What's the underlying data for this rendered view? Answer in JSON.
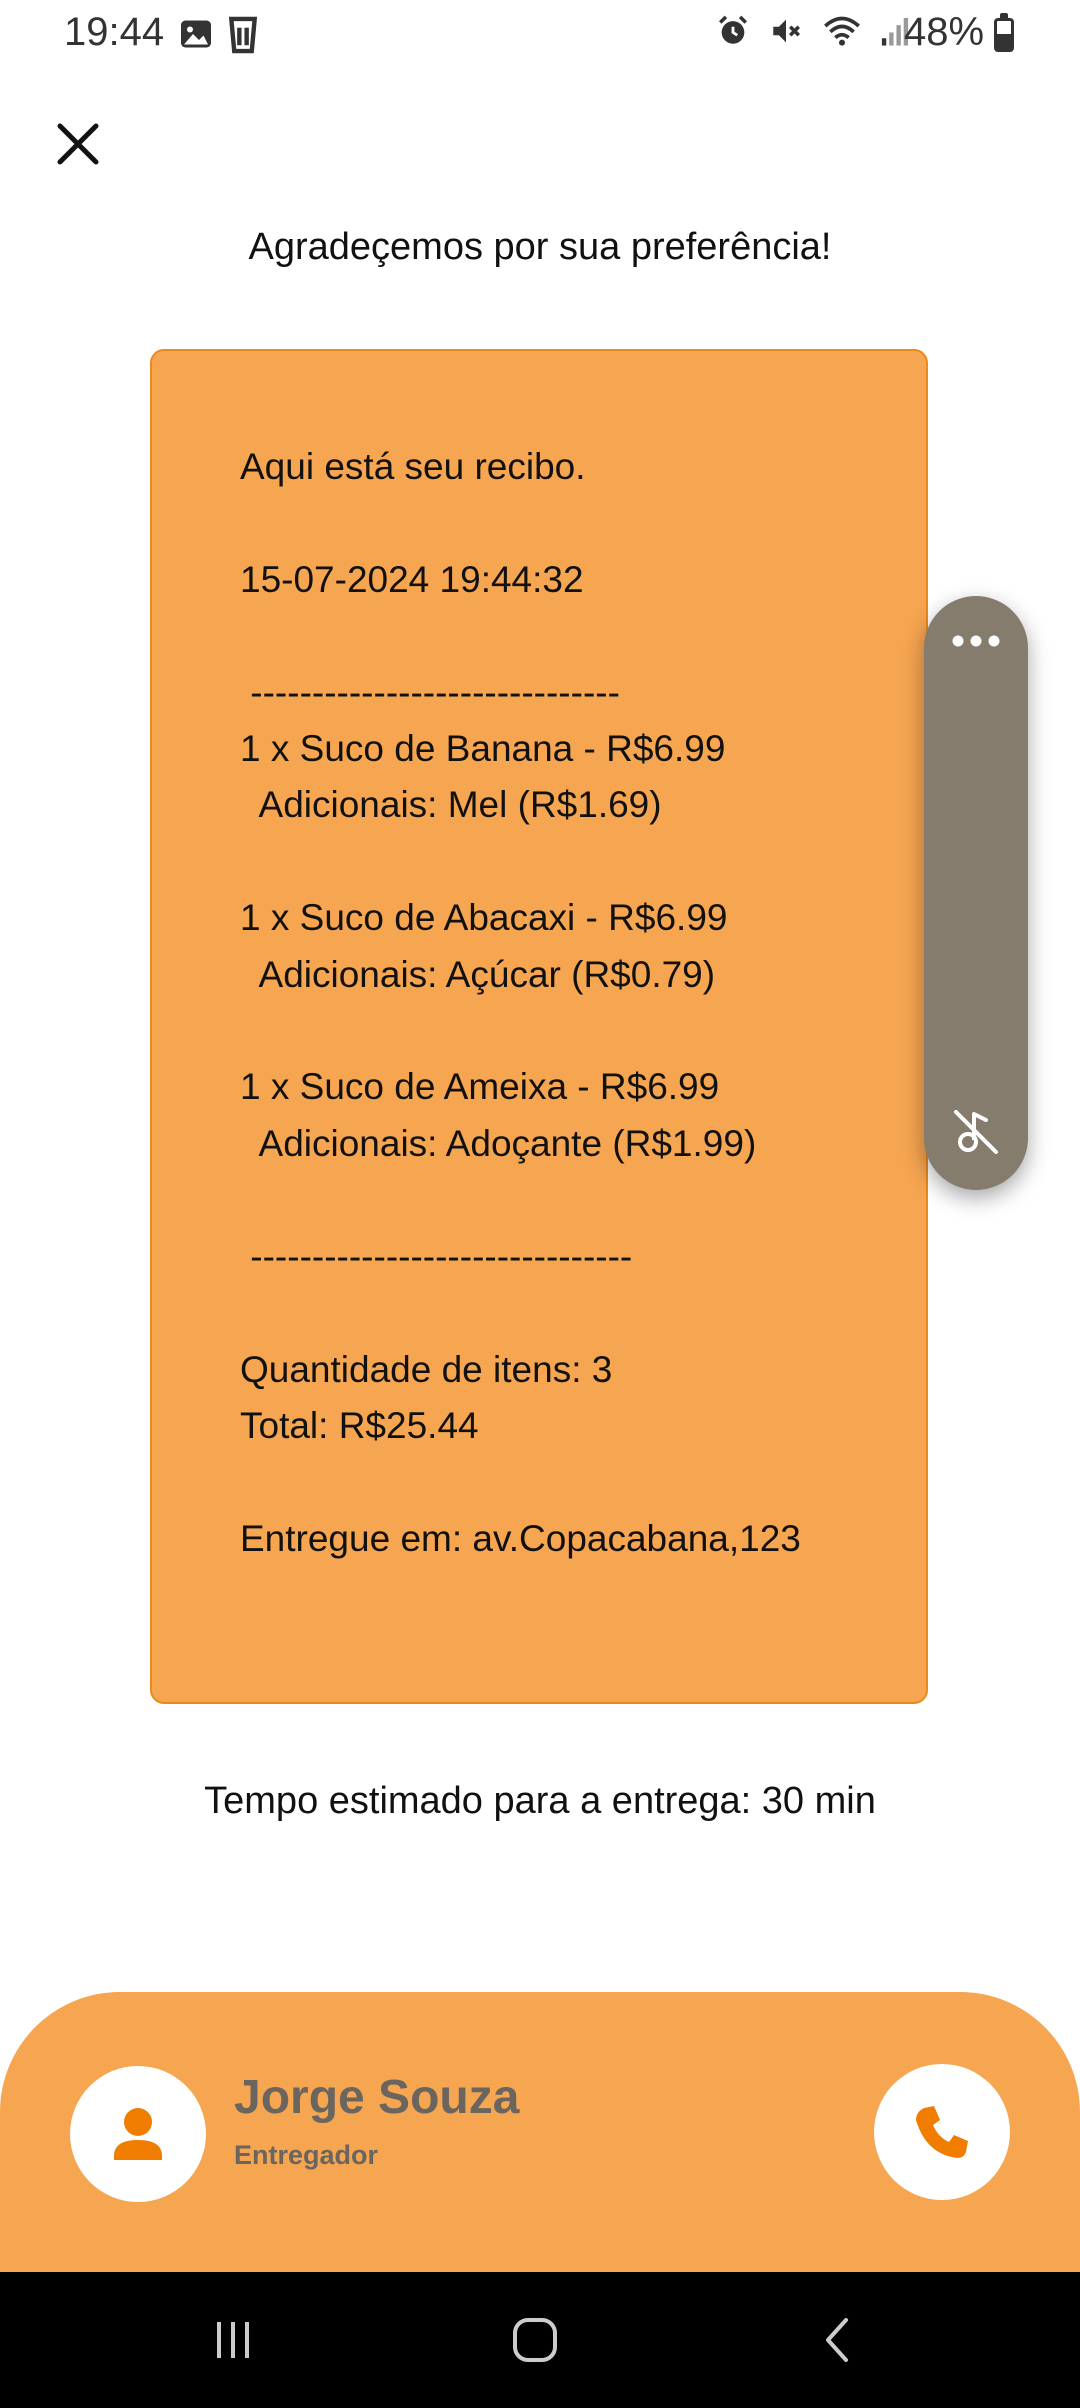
{
  "status_bar": {
    "time": "19:44",
    "battery": "48%",
    "left_icons": [
      "image-icon",
      "cup-icon"
    ],
    "right_icons": [
      "alarm-icon",
      "mute-icon",
      "wifi-icon",
      "signal-icon",
      "battery-icon"
    ]
  },
  "header": {
    "close_icon": "close-icon",
    "thanks": "Agradeçemos por sua preferência!"
  },
  "receipt": {
    "lines": [
      "Aqui está seu recibo.",
      "",
      "15-07-2024 19:44:32",
      "",
      " ------------------------------",
      "1 x Suco de Banana - R$6.99",
      "  Adicionais: Mel (R$1.69)",
      "",
      "1 x Suco de Abacaxi - R$6.99",
      "  Adicionais: Açúcar (R$0.79)",
      "",
      "1 x Suco de Ameixa - R$6.99",
      "  Adicionais: Adoçante (R$1.99)",
      "",
      " -------------------------------",
      "",
      "Quantidade de itens: 3",
      "Total: R$25.44",
      "",
      "Entregue em: av.Copacabana,123"
    ]
  },
  "eta": "Tempo estimado para a entrega: 30 min",
  "courier": {
    "name": "Jorge Souza",
    "role": "Entregador",
    "avatar_icon": "person-icon",
    "call_icon": "phone-icon"
  },
  "floating_panel": {
    "more_icon": "more-dots-icon",
    "mute_icon": "music-off-icon"
  },
  "colors": {
    "accent": "#f6a550",
    "accent_dark": "#f07d00",
    "text_muted": "#6b6560"
  }
}
